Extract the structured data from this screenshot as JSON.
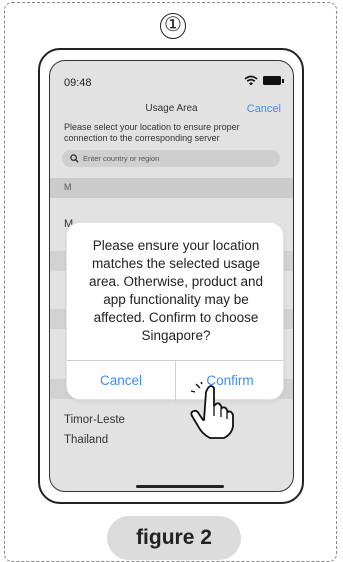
{
  "step": {
    "number": "①"
  },
  "status_bar": {
    "time": "09:48"
  },
  "screen": {
    "title": "Usage Area",
    "cancel_label": "Cancel",
    "description": "Please select your location to ensure proper connection to the corresponding server",
    "search": {
      "placeholder": "Enter country or region"
    },
    "section_header": "M",
    "partial_row_text": "M",
    "list_items": [
      "Timor-Leste",
      "Thailand"
    ]
  },
  "dialog": {
    "message": "Please ensure your location matches the selected usage area. Otherwise, product and app functionality may be affected. Confirm to choose Singapore?",
    "cancel_label": "Cancel",
    "confirm_label": "Confirm"
  },
  "figure_label": "figure 2",
  "colors": {
    "accent": "#3e8fe8",
    "screen_bg": "#e2e2e2",
    "section_bg": "#cbcbcb"
  }
}
